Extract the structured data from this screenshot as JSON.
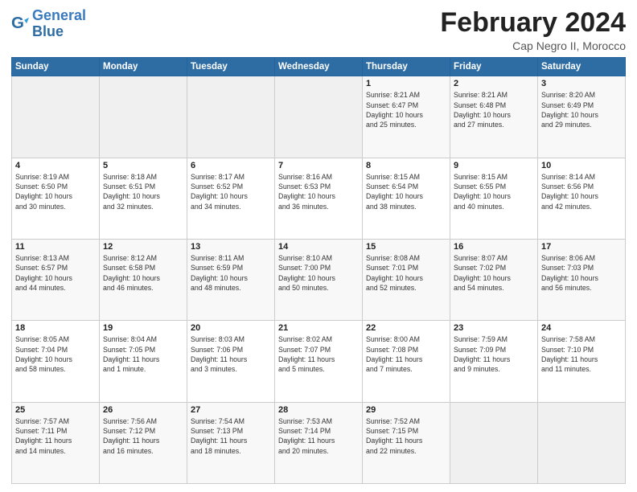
{
  "header": {
    "logo_line1": "General",
    "logo_line2": "Blue",
    "month_year": "February 2024",
    "location": "Cap Negro II, Morocco"
  },
  "weekdays": [
    "Sunday",
    "Monday",
    "Tuesday",
    "Wednesday",
    "Thursday",
    "Friday",
    "Saturday"
  ],
  "weeks": [
    [
      {
        "day": "",
        "info": ""
      },
      {
        "day": "",
        "info": ""
      },
      {
        "day": "",
        "info": ""
      },
      {
        "day": "",
        "info": ""
      },
      {
        "day": "1",
        "info": "Sunrise: 8:21 AM\nSunset: 6:47 PM\nDaylight: 10 hours\nand 25 minutes."
      },
      {
        "day": "2",
        "info": "Sunrise: 8:21 AM\nSunset: 6:48 PM\nDaylight: 10 hours\nand 27 minutes."
      },
      {
        "day": "3",
        "info": "Sunrise: 8:20 AM\nSunset: 6:49 PM\nDaylight: 10 hours\nand 29 minutes."
      }
    ],
    [
      {
        "day": "4",
        "info": "Sunrise: 8:19 AM\nSunset: 6:50 PM\nDaylight: 10 hours\nand 30 minutes."
      },
      {
        "day": "5",
        "info": "Sunrise: 8:18 AM\nSunset: 6:51 PM\nDaylight: 10 hours\nand 32 minutes."
      },
      {
        "day": "6",
        "info": "Sunrise: 8:17 AM\nSunset: 6:52 PM\nDaylight: 10 hours\nand 34 minutes."
      },
      {
        "day": "7",
        "info": "Sunrise: 8:16 AM\nSunset: 6:53 PM\nDaylight: 10 hours\nand 36 minutes."
      },
      {
        "day": "8",
        "info": "Sunrise: 8:15 AM\nSunset: 6:54 PM\nDaylight: 10 hours\nand 38 minutes."
      },
      {
        "day": "9",
        "info": "Sunrise: 8:15 AM\nSunset: 6:55 PM\nDaylight: 10 hours\nand 40 minutes."
      },
      {
        "day": "10",
        "info": "Sunrise: 8:14 AM\nSunset: 6:56 PM\nDaylight: 10 hours\nand 42 minutes."
      }
    ],
    [
      {
        "day": "11",
        "info": "Sunrise: 8:13 AM\nSunset: 6:57 PM\nDaylight: 10 hours\nand 44 minutes."
      },
      {
        "day": "12",
        "info": "Sunrise: 8:12 AM\nSunset: 6:58 PM\nDaylight: 10 hours\nand 46 minutes."
      },
      {
        "day": "13",
        "info": "Sunrise: 8:11 AM\nSunset: 6:59 PM\nDaylight: 10 hours\nand 48 minutes."
      },
      {
        "day": "14",
        "info": "Sunrise: 8:10 AM\nSunset: 7:00 PM\nDaylight: 10 hours\nand 50 minutes."
      },
      {
        "day": "15",
        "info": "Sunrise: 8:08 AM\nSunset: 7:01 PM\nDaylight: 10 hours\nand 52 minutes."
      },
      {
        "day": "16",
        "info": "Sunrise: 8:07 AM\nSunset: 7:02 PM\nDaylight: 10 hours\nand 54 minutes."
      },
      {
        "day": "17",
        "info": "Sunrise: 8:06 AM\nSunset: 7:03 PM\nDaylight: 10 hours\nand 56 minutes."
      }
    ],
    [
      {
        "day": "18",
        "info": "Sunrise: 8:05 AM\nSunset: 7:04 PM\nDaylight: 10 hours\nand 58 minutes."
      },
      {
        "day": "19",
        "info": "Sunrise: 8:04 AM\nSunset: 7:05 PM\nDaylight: 11 hours\nand 1 minute."
      },
      {
        "day": "20",
        "info": "Sunrise: 8:03 AM\nSunset: 7:06 PM\nDaylight: 11 hours\nand 3 minutes."
      },
      {
        "day": "21",
        "info": "Sunrise: 8:02 AM\nSunset: 7:07 PM\nDaylight: 11 hours\nand 5 minutes."
      },
      {
        "day": "22",
        "info": "Sunrise: 8:00 AM\nSunset: 7:08 PM\nDaylight: 11 hours\nand 7 minutes."
      },
      {
        "day": "23",
        "info": "Sunrise: 7:59 AM\nSunset: 7:09 PM\nDaylight: 11 hours\nand 9 minutes."
      },
      {
        "day": "24",
        "info": "Sunrise: 7:58 AM\nSunset: 7:10 PM\nDaylight: 11 hours\nand 11 minutes."
      }
    ],
    [
      {
        "day": "25",
        "info": "Sunrise: 7:57 AM\nSunset: 7:11 PM\nDaylight: 11 hours\nand 14 minutes."
      },
      {
        "day": "26",
        "info": "Sunrise: 7:56 AM\nSunset: 7:12 PM\nDaylight: 11 hours\nand 16 minutes."
      },
      {
        "day": "27",
        "info": "Sunrise: 7:54 AM\nSunset: 7:13 PM\nDaylight: 11 hours\nand 18 minutes."
      },
      {
        "day": "28",
        "info": "Sunrise: 7:53 AM\nSunset: 7:14 PM\nDaylight: 11 hours\nand 20 minutes."
      },
      {
        "day": "29",
        "info": "Sunrise: 7:52 AM\nSunset: 7:15 PM\nDaylight: 11 hours\nand 22 minutes."
      },
      {
        "day": "",
        "info": ""
      },
      {
        "day": "",
        "info": ""
      }
    ]
  ]
}
